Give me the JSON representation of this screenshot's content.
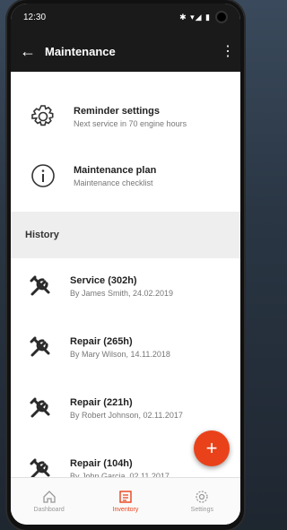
{
  "status": {
    "time": "12:30",
    "icons": "✱ ▾◢ ▮"
  },
  "appbar": {
    "back": "←",
    "title": "Maintenance",
    "menu": "⋮"
  },
  "settings": [
    {
      "title": "Reminder settings",
      "subtitle": "Next service in 70 engine hours",
      "icon": "gear-icon"
    },
    {
      "title": "Maintenance plan",
      "subtitle": "Maintenance checklist",
      "icon": "info-icon"
    }
  ],
  "history": {
    "label": "History",
    "items": [
      {
        "title": "Service (302h)",
        "subtitle": "By James Smith, 24.02.2019",
        "icon": "tools-icon"
      },
      {
        "title": "Repair (265h)",
        "subtitle": "By Mary Wilson, 14.11.2018",
        "icon": "tools-icon"
      },
      {
        "title": "Repair (221h)",
        "subtitle": "By Robert Johnson, 02.11.2017",
        "icon": "tools-icon"
      },
      {
        "title": "Repair (104h)",
        "subtitle": "By John Garcia, 02.11.2017",
        "icon": "tools-icon"
      }
    ]
  },
  "fab": {
    "label": "+"
  },
  "nav": [
    {
      "label": "Dashboard",
      "icon": "home-icon",
      "active": false
    },
    {
      "label": "Inventory",
      "icon": "inventory-icon",
      "active": true
    },
    {
      "label": "Settings",
      "icon": "settings-icon",
      "active": false
    }
  ],
  "colors": {
    "accent": "#e9421a",
    "appbar": "#1a1a1a"
  }
}
